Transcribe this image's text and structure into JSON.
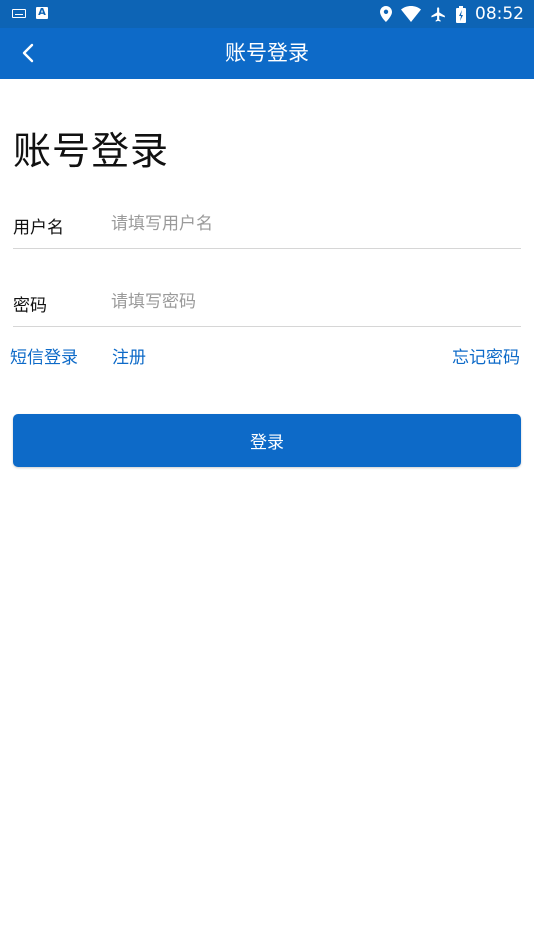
{
  "status_bar": {
    "time": "08:52",
    "icons": [
      "keyboard-icon",
      "a-notification-icon",
      "location-icon",
      "wifi-icon",
      "airplane-icon",
      "battery-icon"
    ],
    "a_icon_text": "A"
  },
  "app_bar": {
    "title": "账号登录",
    "back_icon": "chevron-left-icon"
  },
  "page": {
    "heading": "账号登录"
  },
  "form": {
    "username": {
      "label": "用户名",
      "placeholder": "请填写用户名",
      "value": ""
    },
    "password": {
      "label": "密码",
      "placeholder": "请填写密码",
      "value": ""
    }
  },
  "links": {
    "sms_login": "短信登录",
    "register": "注册",
    "forgot_password": "忘记密码"
  },
  "login_button": {
    "label": "登录"
  },
  "colors": {
    "status_bar": "#0d64b5",
    "primary": "#0d6ac8",
    "divider": "#d6d6d6",
    "placeholder": "#9a9a9a"
  }
}
